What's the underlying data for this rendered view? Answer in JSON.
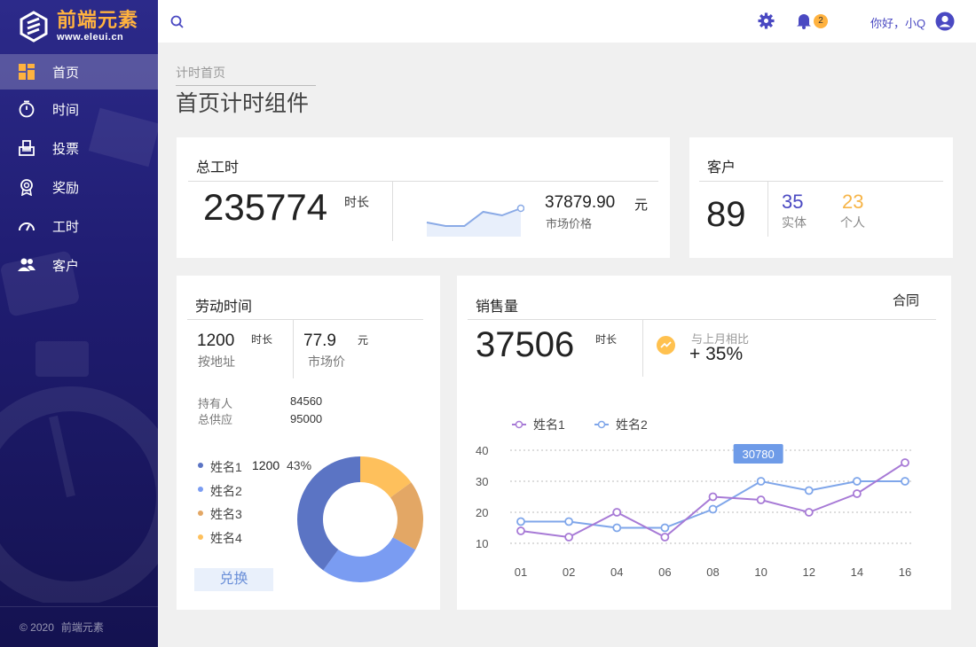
{
  "brand": {
    "title": "前端元素",
    "subtitle": "www.eleui.cn"
  },
  "sidebar": {
    "items": [
      {
        "label": "首页",
        "icon": "dashboard-icon",
        "active": true
      },
      {
        "label": "时间",
        "icon": "stopwatch-icon"
      },
      {
        "label": "投票",
        "icon": "ballot-box-icon"
      },
      {
        "label": "奖励",
        "icon": "award-icon"
      },
      {
        "label": "工时",
        "icon": "speedometer-icon"
      },
      {
        "label": "客户",
        "icon": "users-icon"
      }
    ],
    "footer": {
      "copyright": "© 2020",
      "name": "前端元素"
    }
  },
  "topbar": {
    "badge": "2",
    "greeting": "你好，小Q"
  },
  "breadcrumb": "计时首页",
  "page_title": "首页计时组件",
  "total_hours": {
    "title": "总工时",
    "value": "235774",
    "unit": "时长",
    "price": "37879.90",
    "price_unit": "元",
    "price_label": "市场价格",
    "sparkline": [
      3,
      2,
      2,
      6,
      5,
      7
    ]
  },
  "customers": {
    "title": "客户",
    "total": "89",
    "entity_value": "35",
    "entity_label": "实体",
    "person_value": "23",
    "person_label": "个人"
  },
  "labor": {
    "title": "劳动时间",
    "hours": "1200",
    "hours_unit": "时长",
    "hours_label": "按地址",
    "price": "77.9",
    "price_unit": "元",
    "price_label": "市场价",
    "holder_label": "持有人",
    "holder_value": "84560",
    "supply_label": "总供应",
    "supply_value": "95000",
    "legend": [
      {
        "name": "姓名1",
        "value": "1200",
        "percent": "43%",
        "color": "#5b74c4"
      },
      {
        "name": "姓名2",
        "color": "#7a9cf2"
      },
      {
        "name": "姓名3",
        "color": "#e3a765"
      },
      {
        "name": "姓名4",
        "color": "#fec05c"
      }
    ],
    "donut": [
      40,
      27,
      18,
      15
    ],
    "button": "兑换"
  },
  "sales": {
    "title": "销售量",
    "link": "合同",
    "value": "37506",
    "unit": "时长",
    "compare_label": "与上月相比",
    "compare_value": "+ 35%"
  },
  "chart_data": {
    "type": "line",
    "categories": [
      "01",
      "02",
      "04",
      "06",
      "08",
      "10",
      "12",
      "14",
      "16"
    ],
    "series": [
      {
        "name": "姓名1",
        "color": "#a77ad6",
        "values": [
          14,
          12,
          20,
          12,
          25,
          24,
          20,
          26,
          36
        ]
      },
      {
        "name": "姓名2",
        "color": "#7fa6ea",
        "values": [
          17,
          17,
          15,
          15,
          21,
          30,
          27,
          30,
          30
        ]
      }
    ],
    "yticks": [
      "10",
      "20",
      "30",
      "40"
    ],
    "ylim": [
      10,
      40
    ],
    "tooltip": "30780",
    "grid": true,
    "legend_position": "top-left"
  }
}
